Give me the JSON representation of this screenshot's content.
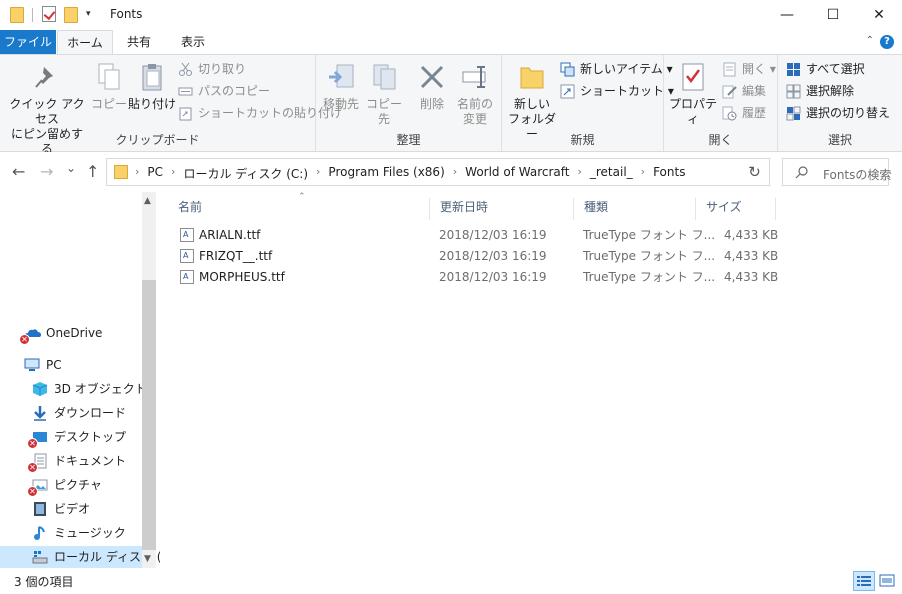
{
  "window": {
    "title": "Fonts",
    "qa_dropdown": "▾",
    "minimize": "—",
    "maximize": "☐",
    "close": "✕"
  },
  "tabs": {
    "file": "ファイル",
    "home": "ホーム",
    "share": "共有",
    "view": "表示",
    "collapse": "⌃",
    "help": "?"
  },
  "ribbon": {
    "clipboard": {
      "label": "クリップボード",
      "pin_line1": "クイック アクセス",
      "pin_line2": "にピン留めする",
      "copy": "コピー",
      "paste": "貼り付け",
      "cut": "切り取り",
      "copy_path": "パスのコピー",
      "paste_shortcut": "ショートカットの貼り付け"
    },
    "organize": {
      "label": "整理",
      "move_to": "移動先",
      "copy_to": "コピー先",
      "delete": "削除",
      "rename_line1": "名前の",
      "rename_line2": "変更"
    },
    "new": {
      "label": "新規",
      "new_folder_line1": "新しい",
      "new_folder_line2": "フォルダー",
      "new_item": "新しいアイテム",
      "easy_access": "ショートカット"
    },
    "open": {
      "label": "開く",
      "properties": "プロパティ",
      "open": "開く",
      "edit": "編集",
      "history": "履歴"
    },
    "select": {
      "label": "選択",
      "select_all": "すべて選択",
      "select_none": "選択解除",
      "invert": "選択の切り替え"
    }
  },
  "nav": {
    "back": "←",
    "forward": "→",
    "recent": "⌄",
    "up": "↑",
    "breadcrumbs": [
      "PC",
      "ローカル ディスク (C:)",
      "Program Files (x86)",
      "World of Warcraft",
      "_retail_",
      "Fonts"
    ],
    "crumb_sep": "›",
    "refresh": "↻",
    "search_placeholder": "Fontsの検索"
  },
  "navpane": {
    "items": [
      {
        "label": "OneDrive"
      },
      {
        "label": "PC"
      },
      {
        "label": "3D オブジェクト"
      },
      {
        "label": "ダウンロード"
      },
      {
        "label": "デスクトップ"
      },
      {
        "label": "ドキュメント"
      },
      {
        "label": "ピクチャ"
      },
      {
        "label": "ビデオ"
      },
      {
        "label": "ミュージック"
      },
      {
        "label": "ローカル ディスク (C"
      }
    ]
  },
  "filelist": {
    "columns": {
      "name": "名前",
      "modified": "更新日時",
      "type": "種類",
      "size": "サイズ"
    },
    "sort_arrow": "⌃",
    "rows": [
      {
        "name": "ARIALN.ttf",
        "modified": "2018/12/03 16:19",
        "type": "TrueType フォント フ...",
        "size": "4,433 KB"
      },
      {
        "name": "FRIZQT__.ttf",
        "modified": "2018/12/03 16:19",
        "type": "TrueType フォント フ...",
        "size": "4,433 KB"
      },
      {
        "name": "MORPHEUS.ttf",
        "modified": "2018/12/03 16:19",
        "type": "TrueType フォント フ...",
        "size": "4,433 KB"
      }
    ]
  },
  "status": {
    "count": "3 個の項目"
  },
  "colors": {
    "accent": "#1979ca",
    "error_badge": "#d13438",
    "selected_bg": "#cce8ff",
    "folder": "#f8d169"
  }
}
